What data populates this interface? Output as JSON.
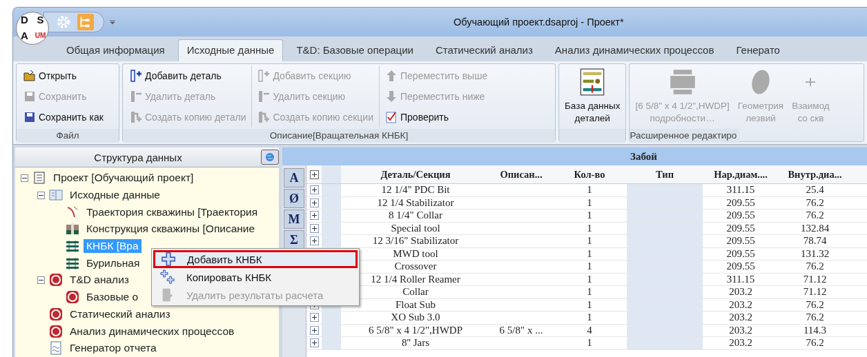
{
  "window": {
    "title": "Обучающий проект.dsaproj - Проект*",
    "logo": {
      "top": [
        "D",
        "S"
      ],
      "bottom": [
        "A",
        "UM"
      ]
    }
  },
  "tabs": [
    {
      "label": "Общая информация",
      "selected": false
    },
    {
      "label": "Исходные данные",
      "selected": true
    },
    {
      "label": "T&D: Базовые операции",
      "selected": false
    },
    {
      "label": "Статический анализ",
      "selected": false
    },
    {
      "label": "Анализ динамических процессов",
      "selected": false
    },
    {
      "label": "Генерато",
      "selected": false
    }
  ],
  "ribbon": {
    "groups": [
      {
        "caption": "Файл",
        "columns": [
          [
            {
              "label": "Открыть",
              "kind": "open",
              "disabled": false
            },
            {
              "label": "Сохранить",
              "kind": "save",
              "disabled": true
            },
            {
              "label": "Сохранить как",
              "kind": "saveas",
              "disabled": false
            }
          ]
        ]
      },
      {
        "caption": "Описание[Вращательная КНБК]",
        "columns": [
          [
            {
              "label": "Добавить деталь",
              "kind": "add",
              "disabled": false
            },
            {
              "label": "Удалить деталь",
              "kind": "remove",
              "disabled": true
            },
            {
              "label": "Создать копию детали",
              "kind": "copy",
              "disabled": true
            }
          ],
          [
            {
              "label": "Добавить секцию",
              "kind": "add",
              "disabled": true
            },
            {
              "label": "Удалить секцию",
              "kind": "remove",
              "disabled": true
            },
            {
              "label": "Создать копию секции",
              "kind": "copy",
              "disabled": true
            }
          ],
          [
            {
              "label": "Переместить выше",
              "kind": "up",
              "disabled": true
            },
            {
              "label": "Переместить ниже",
              "kind": "down",
              "disabled": true
            },
            {
              "label": "Проверить",
              "kind": "check",
              "disabled": false
            }
          ]
        ]
      },
      {
        "large": [
          {
            "lines": [
              "База данных",
              "деталей"
            ],
            "kind": "database",
            "disabled": false
          }
        ]
      },
      {
        "caption": "Расширенное редактиро",
        "large": [
          {
            "lines": [
              "[6 5/8\" x 4 1/2\",HWDP]",
              "подробности…"
            ],
            "kind": "pipe",
            "disabled": true
          },
          {
            "lines": [
              "Геометрия",
              "лезвий"
            ],
            "kind": "blade",
            "disabled": true
          },
          {
            "lines": [
              "Взаимод",
              "со скв"
            ],
            "kind": "interact",
            "disabled": true
          }
        ]
      }
    ]
  },
  "tree_panel": {
    "title": "Структура данных"
  },
  "tree": [
    {
      "label": "Проект [Обучающий проект]",
      "kind": "project",
      "expanded": true,
      "selected": false,
      "children": [
        {
          "label": "Исходные данные",
          "kind": "data",
          "expanded": true,
          "selected": false,
          "children": [
            {
              "label": "Траектория скважины [Траектория",
              "kind": "trajectory",
              "selected": false
            },
            {
              "label": "Конструкция скважины [Описание",
              "kind": "construction",
              "selected": false
            },
            {
              "label": "КНБК [Вра",
              "kind": "bha",
              "selected": true
            },
            {
              "label": "Бурильная",
              "kind": "bha",
              "selected": false
            }
          ]
        },
        {
          "label": "T&D анализ",
          "kind": "analysis",
          "expanded": true,
          "selected": false,
          "children": [
            {
              "label": "Базовые о",
              "kind": "analysis",
              "selected": false
            }
          ]
        },
        {
          "label": "Статический анализ",
          "kind": "analysis",
          "selected": false
        },
        {
          "label": "Анализ динамических процессов",
          "kind": "analysis",
          "selected": false
        },
        {
          "label": "Генератор отчета",
          "kind": "report",
          "selected": false
        }
      ]
    }
  ],
  "context_menu": [
    {
      "label": "Добавить КНБК",
      "kind": "add",
      "disabled": false,
      "selected": true
    },
    {
      "label": "Копировать КНБК",
      "kind": "copy",
      "disabled": false,
      "selected": false
    },
    {
      "label": "Удалить результаты расчета",
      "kind": "delete",
      "disabled": true,
      "selected": false
    }
  ],
  "side_tools": [
    {
      "label": "A"
    },
    {
      "label": "Ø"
    },
    {
      "label": "M"
    },
    {
      "label": "Σ"
    }
  ],
  "table": {
    "band": "Забой",
    "columns": [
      "Деталь/Секция",
      "Описан...",
      "Кол-во",
      "Тип",
      "Нар.диам....",
      "Внутр.диа..."
    ],
    "rows": [
      [
        "12 1/4\" PDC Bit",
        "",
        "1",
        "",
        "311.15",
        "25.4"
      ],
      [
        "12 1/4 Stabilizator",
        "",
        "1",
        "",
        "209.55",
        "76.2"
      ],
      [
        "8 1/4\" Collar",
        "",
        "1",
        "",
        "209.55",
        "76.2"
      ],
      [
        "Special tool",
        "",
        "1",
        "",
        "209.55",
        "132.84"
      ],
      [
        "12 3/16\" Stabilizator",
        "",
        "1",
        "",
        "209.55",
        "78.74"
      ],
      [
        "MWD tool",
        "",
        "1",
        "",
        "209.55",
        "131.32"
      ],
      [
        "Crossover",
        "",
        "1",
        "",
        "209.55",
        "76.2"
      ],
      [
        "12 1/4 Roller Reamer",
        "",
        "1",
        "",
        "311.15",
        "71.12"
      ],
      [
        "Collar",
        "",
        "1",
        "",
        "203.2",
        "71.12"
      ],
      [
        "Float Sub",
        "",
        "1",
        "",
        "203.2",
        "76.2"
      ],
      [
        "XO Sub 3.0",
        "",
        "1",
        "",
        "203.2",
        "76.2"
      ],
      [
        "6 5/8\" x 4 1/2\",HWDP",
        "6 5/8\" x ...",
        "4",
        "",
        "203.2",
        "114.3"
      ],
      [
        "8'' Jars",
        "",
        "1",
        "",
        "203.2",
        "76.2"
      ]
    ]
  }
}
